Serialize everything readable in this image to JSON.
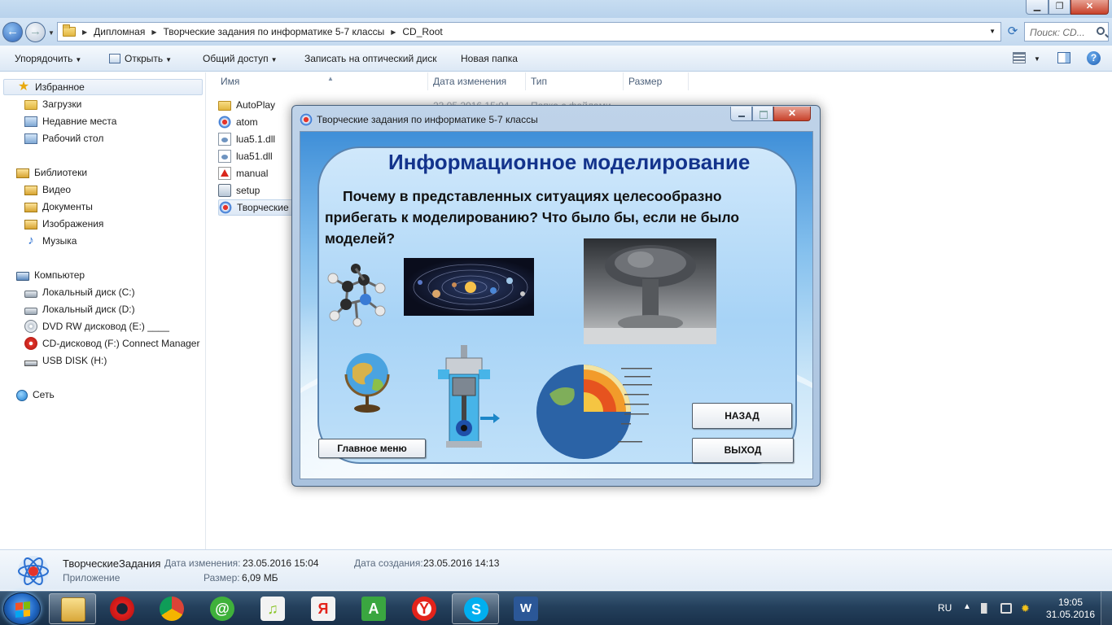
{
  "explorer": {
    "breadcrumbs": [
      "Дипломная",
      "Творческие задания по информатике 5-7 классы",
      "CD_Root"
    ],
    "search_placeholder": "Поиск: CD...",
    "toolbar": {
      "organize": "Упорядочить",
      "open": "Открыть",
      "share": "Общий доступ",
      "burn": "Записать на оптический диск",
      "new_folder": "Новая папка"
    },
    "nav": {
      "favorites": "Избранное",
      "downloads": "Загрузки",
      "recent": "Недавние места",
      "desktop": "Рабочий стол",
      "libraries": "Библиотеки",
      "video": "Видео",
      "documents": "Документы",
      "images": "Изображения",
      "music": "Музыка",
      "computer": "Компьютер",
      "disk_c": "Локальный диск (C:)",
      "disk_d": "Локальный диск (D:)",
      "dvd_e": "DVD RW дисковод (E:) ____",
      "cd_f": "CD-дисковод (F:) Connect Manager",
      "usb_h": "USB DISK (H:)",
      "network": "Сеть"
    },
    "columns": {
      "name": "Имя",
      "date": "Дата изменения",
      "type": "Тип",
      "size": "Размер"
    },
    "files": [
      "AutoPlay",
      "atom",
      "lua5.1.dll",
      "lua51.dll",
      "manual",
      "setup",
      "Творческие"
    ],
    "first_row": {
      "date": "23.05.2016 15:04",
      "type": "Папка с файлами"
    },
    "details": {
      "name": "ТворческиеЗадания",
      "kind": "Приложение",
      "modified_label": "Дата изменения:",
      "modified_value": "23.05.2016 15:04",
      "created_label": "Дата создания:",
      "created_value": "23.05.2016 14:13",
      "size_label": "Размер:",
      "size_value": "6,09 МБ"
    }
  },
  "app": {
    "title": "Творческие задания по информатике 5-7 классы",
    "heading": "Информационное моделирование",
    "question": "Почему в представленных ситуациях целесообразно прибегать к моделированию? Что было бы, если не было моделей?",
    "buttons": {
      "main_menu": "Главное меню",
      "back": "НАЗАД",
      "exit": "ВЫХОД"
    }
  },
  "taskbar": {
    "apps": [
      "explorer-icon",
      "opera-icon",
      "chrome-icon",
      "mail-agent-icon",
      "music-icon",
      "yandex-icon",
      "a-app-icon",
      "yandex-browser-icon",
      "skype-icon",
      "word-icon"
    ],
    "language": "RU",
    "time": "19:05",
    "date": "31.05.2016"
  },
  "colors": {
    "heading": "#13338c",
    "panel_border": "#5a84b0",
    "taskbar": "#24405c"
  }
}
